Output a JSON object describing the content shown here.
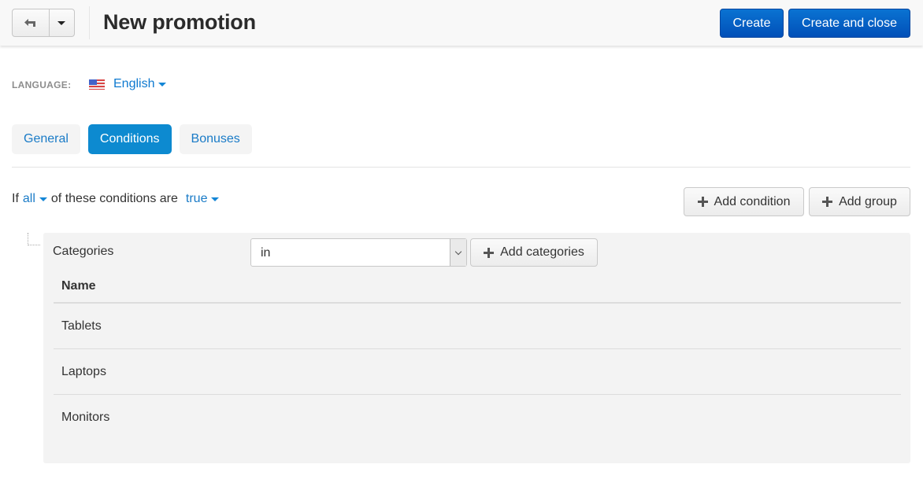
{
  "header": {
    "title": "New promotion",
    "back_icon": "back-arrow-icon",
    "dropdown_icon": "caret-down-icon",
    "create_label": "Create",
    "create_and_close_label": "Create and close",
    "primary_color": "#0a65c8"
  },
  "language": {
    "label": "LANGUAGE:",
    "selected": "English",
    "flag_icon": "us-flag-icon"
  },
  "tabs": [
    {
      "label": "General",
      "active": false
    },
    {
      "label": "Conditions",
      "active": true
    },
    {
      "label": "Bonuses",
      "active": false
    }
  ],
  "conditions": {
    "prefix": "If",
    "match": "all",
    "middle": "of these conditions are",
    "state": "true",
    "add_condition_label": "Add condition",
    "add_group_label": "Add group"
  },
  "condition_item": {
    "label": "Categories",
    "operator": "in",
    "add_button_label": "Add categories",
    "table": {
      "columns": [
        "Name"
      ],
      "rows": [
        "Tablets",
        "Laptops",
        "Monitors"
      ]
    }
  }
}
